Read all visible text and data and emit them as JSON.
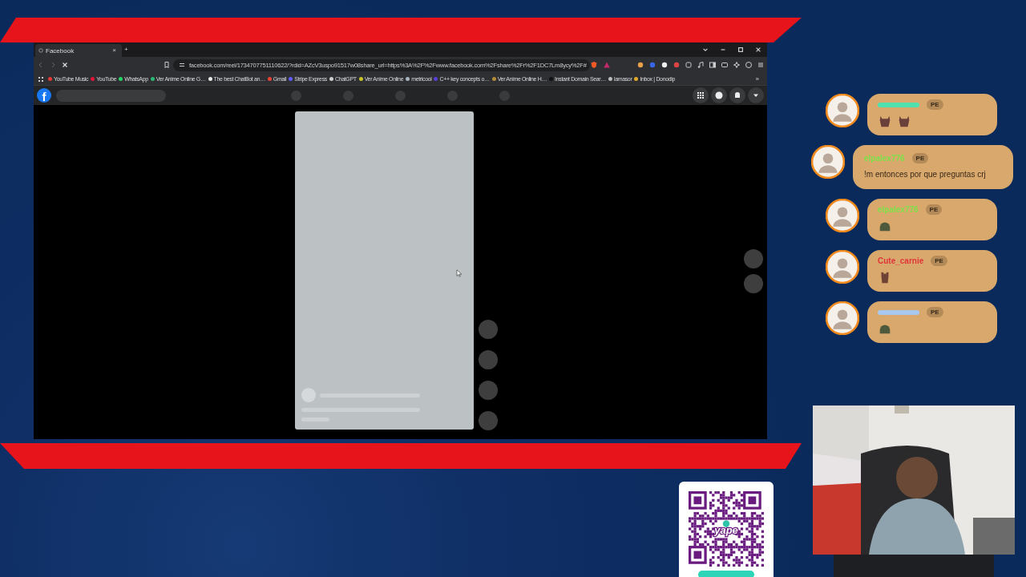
{
  "browser": {
    "tabs": [
      {
        "label": "Facebook",
        "selected": true,
        "close": "×"
      }
    ],
    "new_tab": "+",
    "url": "facebook.com/reel/1734707751110622/?rdid=AZcV3uspo91517w08share_url=https%3A%2F%2Fwww.facebook.com%2Fshare%2Fr%2F1DC7Lm8ycy%2F#",
    "bookmarks": [
      {
        "label": "YouTube Music",
        "color": "#e53935"
      },
      {
        "label": "YouTube",
        "color": "#e0163a"
      },
      {
        "label": "WhatsApp",
        "color": "#25d366"
      },
      {
        "label": "Ver Anime Online G…",
        "color": "#2bb673"
      },
      {
        "label": "The best ChatBot an…",
        "color": "#e8e8e8"
      },
      {
        "label": "Gmail",
        "color": "#ea4335"
      },
      {
        "label": "Stripe Express",
        "color": "#635bff"
      },
      {
        "label": "ChatGPT",
        "color": "#cfcfcf"
      },
      {
        "label": "Ver Anime Online",
        "color": "#c9c42a"
      },
      {
        "label": "metricool",
        "color": "#aab4c0"
      },
      {
        "label": "C++ key concepts o…",
        "color": "#5a3fd6"
      },
      {
        "label": "Ver Anime Online H…",
        "color": "#b58a3a"
      },
      {
        "label": "Instant Domain Sear…",
        "color": "#111111"
      },
      {
        "label": "lamasor",
        "color": "#bdbdbd"
      },
      {
        "label": "Inbox | Donodip",
        "color": "#e2a82c"
      }
    ],
    "more": "»",
    "facebook": {
      "logo": "f"
    }
  },
  "chat": [
    {
      "color": "#4fe0b0",
      "badge": "PE",
      "kind": "emotes",
      "emotes": [
        {
          "kind": "llama"
        },
        {
          "kind": "llama"
        }
      ]
    },
    {
      "username": "elpalex776",
      "color": "#7ee24a",
      "badge": "PE",
      "kind": "text",
      "message": "!m entonces por que preguntas crj"
    },
    {
      "username": "elpalex776",
      "color": "#7ee24a",
      "badge": "PE",
      "kind": "emotes",
      "emotes": [
        {
          "kind": "turtle"
        }
      ]
    },
    {
      "username": "Cute_carnie",
      "color": "#e0343a",
      "badge": "PE",
      "kind": "emotes",
      "emotes": [
        {
          "kind": "bear"
        }
      ]
    },
    {
      "color": "#a9c8ef",
      "badge": "PE",
      "kind": "emotes",
      "emotes": [
        {
          "kind": "turtle"
        }
      ]
    }
  ],
  "qr": {
    "logo_text": "yape"
  }
}
